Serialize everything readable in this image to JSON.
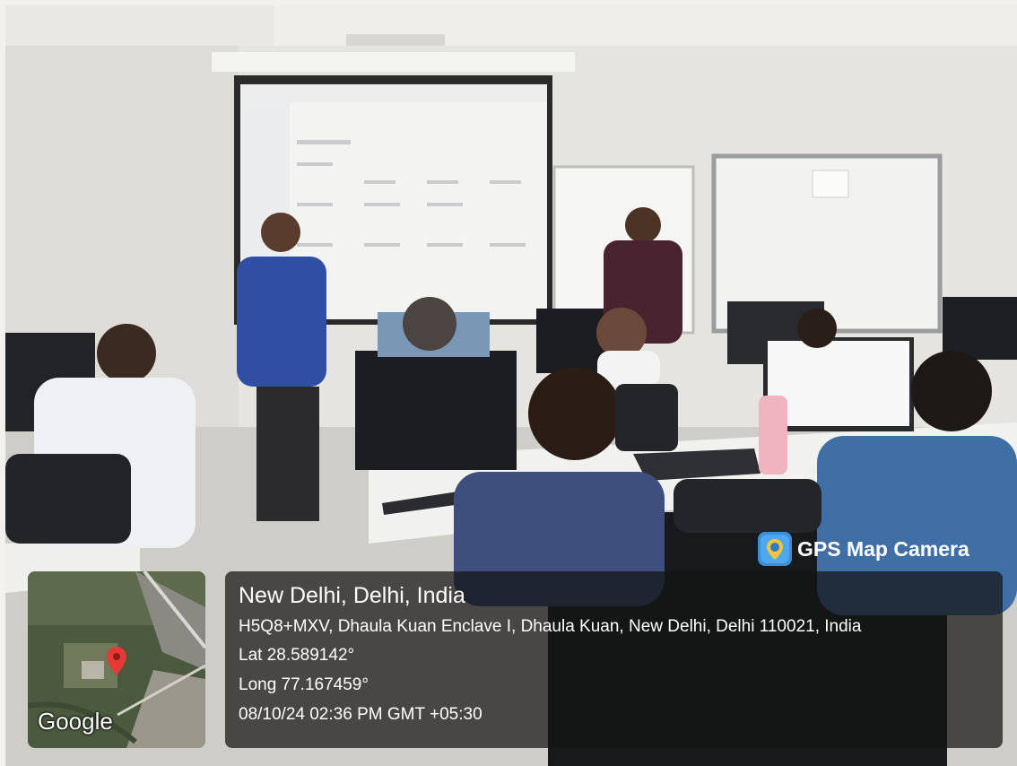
{
  "overlay": {
    "app_name": "GPS Map Camera",
    "location_title": "New Delhi, Delhi, India",
    "address": "H5Q8+MXV, Dhaula Kuan Enclave I, Dhaula Kuan, New Delhi, Delhi 110021, India",
    "latitude": "Lat 28.589142°",
    "longitude": "Long 77.167459°",
    "timestamp": "08/10/24 02:36 PM GMT +05:30",
    "map_provider": "Google"
  },
  "colors": {
    "pin": "#e53935",
    "overlay_bg": "#141414",
    "badge": "#3a8fd8"
  },
  "icons": {
    "app_icon": "map-pin-camera-icon",
    "map_pin": "map-pin-icon"
  }
}
